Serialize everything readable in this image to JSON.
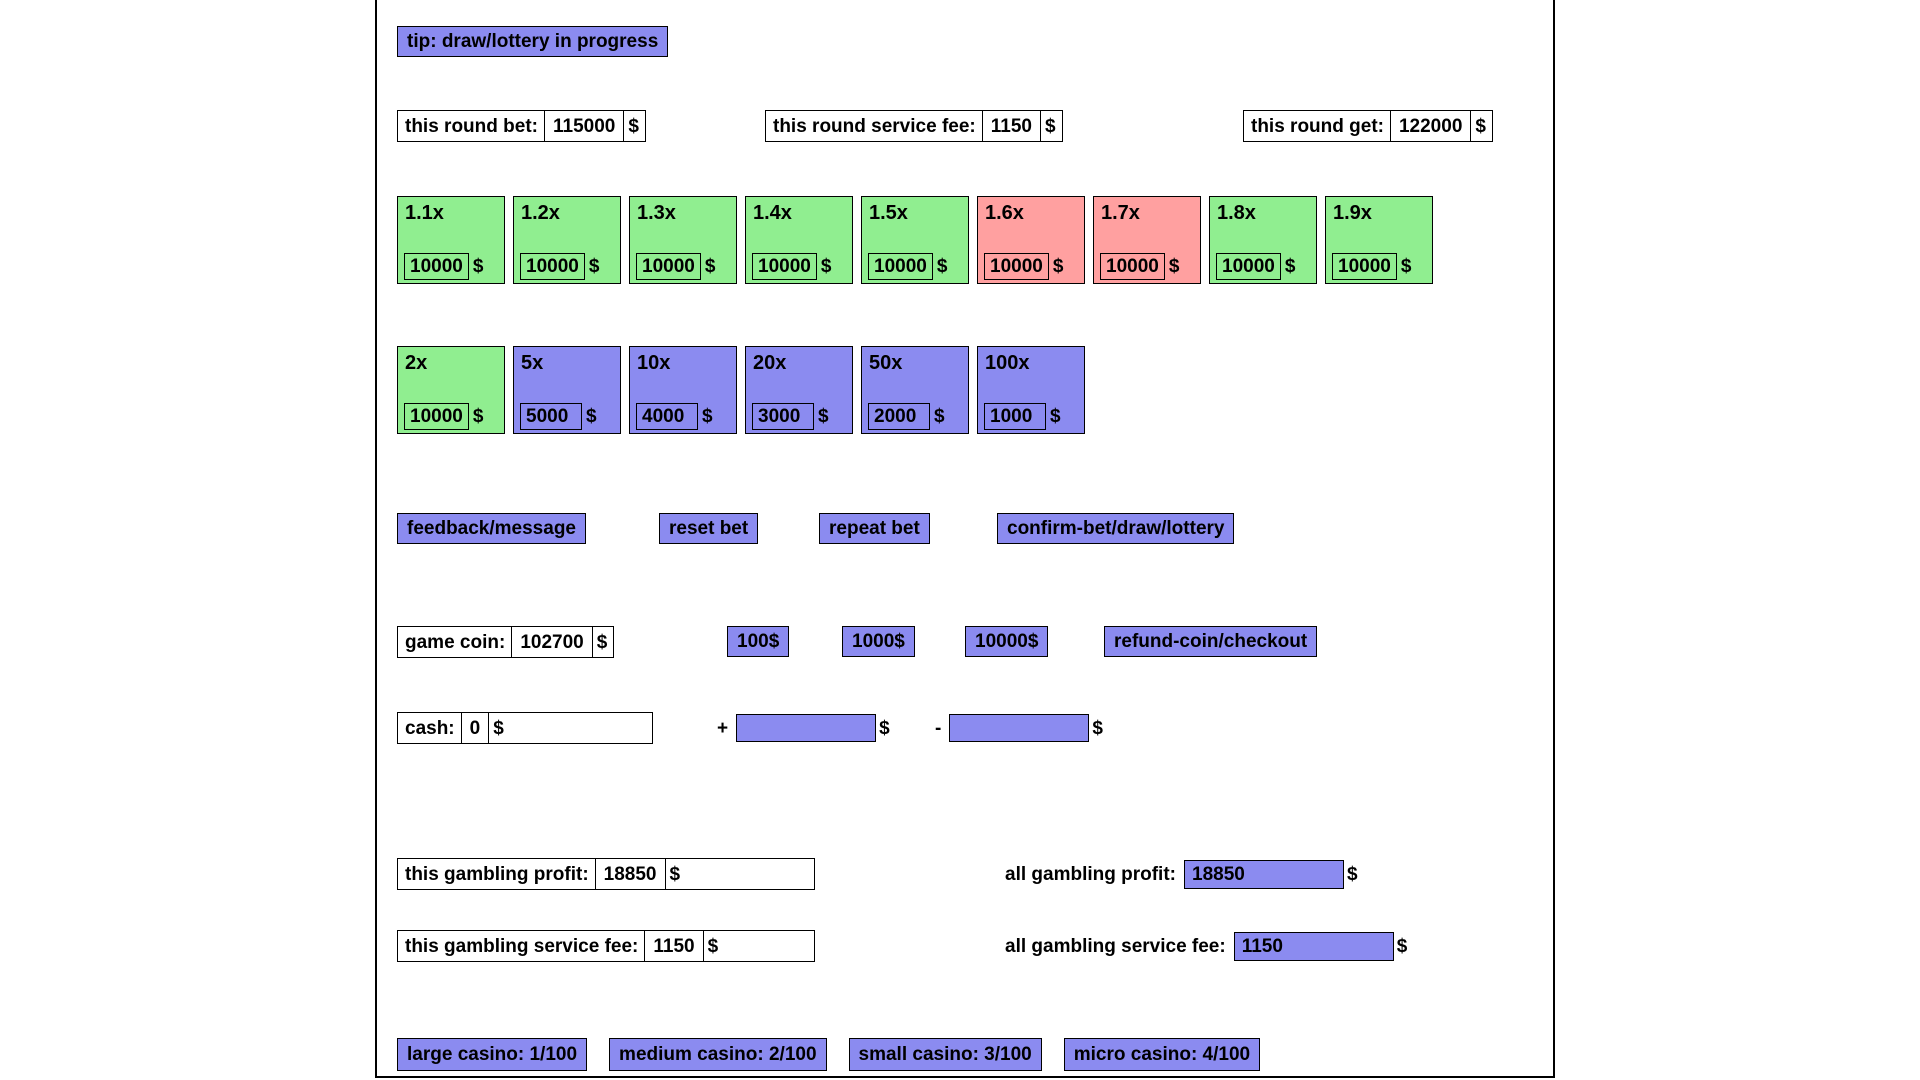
{
  "tip": {
    "text": "tip: draw/lottery in progress"
  },
  "round": {
    "bet": {
      "label": "this round bet:",
      "value": "115000",
      "unit": "$"
    },
    "service_fee": {
      "label": "this round service fee:",
      "value": "1150",
      "unit": "$"
    },
    "get": {
      "label": "this round get:",
      "value": "122000",
      "unit": "$"
    }
  },
  "colors": {
    "green": "#90ee90",
    "red": "#ffa0a0",
    "purple": "#8b8bf0",
    "white": "#ffffff",
    "border": "#000000"
  },
  "bet_cards_row1": [
    {
      "multiplier": "1.1x",
      "amount": "10000",
      "unit": "$",
      "state": "green"
    },
    {
      "multiplier": "1.2x",
      "amount": "10000",
      "unit": "$",
      "state": "green"
    },
    {
      "multiplier": "1.3x",
      "amount": "10000",
      "unit": "$",
      "state": "green"
    },
    {
      "multiplier": "1.4x",
      "amount": "10000",
      "unit": "$",
      "state": "green"
    },
    {
      "multiplier": "1.5x",
      "amount": "10000",
      "unit": "$",
      "state": "green"
    },
    {
      "multiplier": "1.6x",
      "amount": "10000",
      "unit": "$",
      "state": "red"
    },
    {
      "multiplier": "1.7x",
      "amount": "10000",
      "unit": "$",
      "state": "red"
    },
    {
      "multiplier": "1.8x",
      "amount": "10000",
      "unit": "$",
      "state": "green"
    },
    {
      "multiplier": "1.9x",
      "amount": "10000",
      "unit": "$",
      "state": "green"
    }
  ],
  "bet_cards_row2": [
    {
      "multiplier": "2x",
      "amount": "10000",
      "unit": "$",
      "state": "green"
    },
    {
      "multiplier": "5x",
      "amount": "5000",
      "unit": "$",
      "state": "purple"
    },
    {
      "multiplier": "10x",
      "amount": "4000",
      "unit": "$",
      "state": "purple"
    },
    {
      "multiplier": "20x",
      "amount": "3000",
      "unit": "$",
      "state": "purple"
    },
    {
      "multiplier": "50x",
      "amount": "2000",
      "unit": "$",
      "state": "purple"
    },
    {
      "multiplier": "100x",
      "amount": "1000",
      "unit": "$",
      "state": "purple"
    }
  ],
  "actions": {
    "feedback": "feedback/message",
    "reset": "reset bet",
    "repeat": "repeat bet",
    "confirm": "confirm-bet/draw/lottery"
  },
  "coin": {
    "label": "game coin:",
    "value": "102700",
    "unit": "$",
    "quick": [
      {
        "label": "100$"
      },
      {
        "label": "1000$"
      },
      {
        "label": "10000$"
      }
    ],
    "refund": "refund-coin/checkout"
  },
  "cash": {
    "label": "cash:",
    "value": "0",
    "unit": "$",
    "add": {
      "sign": "+",
      "value": "",
      "placeholder": "",
      "unit": "$"
    },
    "subtract": {
      "sign": "-",
      "value": "",
      "placeholder": "",
      "unit": "$"
    }
  },
  "stats": {
    "this_profit": {
      "label": "this gambling profit:",
      "value": "18850",
      "unit": "$"
    },
    "all_profit": {
      "label": "all gambling profit:",
      "value": "18850",
      "unit": "$"
    },
    "this_fee": {
      "label": "this gambling service fee:",
      "value": "1150",
      "unit": "$"
    },
    "all_fee": {
      "label": "all gambling service fee:",
      "value": "1150",
      "unit": "$"
    }
  },
  "casino_tabs": [
    {
      "label": "large casino: 1/100",
      "state": "green"
    },
    {
      "label": "medium casino: 2/100",
      "state": "purple"
    },
    {
      "label": "small casino: 3/100",
      "state": "purple"
    },
    {
      "label": "micro casino: 4/100",
      "state": "purple"
    }
  ]
}
